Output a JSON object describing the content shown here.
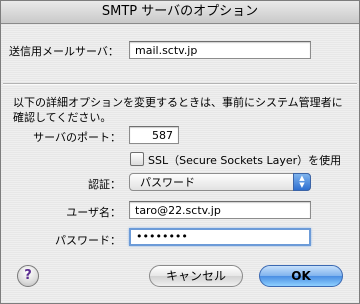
{
  "window": {
    "title": "SMTP サーバのオプション"
  },
  "form": {
    "server_label": "送信用メールサーバ：",
    "server_value": "mail.sctv.jp",
    "description": "以下の詳細オプションを変更するときは、事前にシステム管理者に確認してください。",
    "port_label": "サーバのポート：",
    "port_value": "587",
    "ssl_label": "SSL（Secure Sockets Layer）を使用",
    "ssl_checked": false,
    "auth_label": "認証：",
    "auth_value": "パスワード",
    "username_label": "ユーザ名：",
    "username_value": "taro@22.sctv.jp",
    "password_label": "パスワード：",
    "password_value": "••••••••"
  },
  "buttons": {
    "help": "?",
    "cancel": "キャンセル",
    "ok": "OK"
  }
}
